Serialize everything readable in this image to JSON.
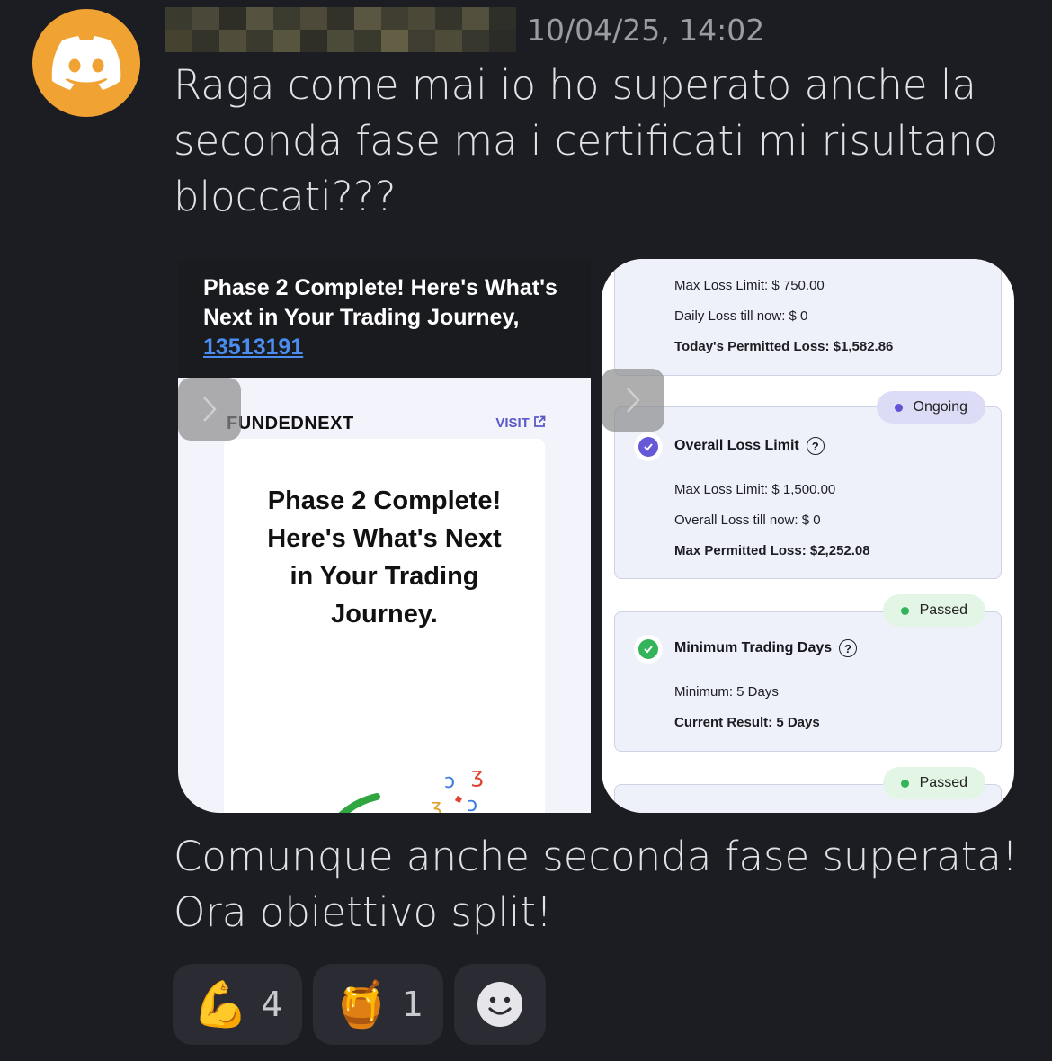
{
  "message": {
    "timestamp": "10/04/25, 14:02",
    "text_1": "Raga come mai io ho superato anche la seconda fase ma i certificati mi risultano bloccati???",
    "text_2": "Comunque anche seconda fase superata! Ora obiettivo split!"
  },
  "attachment_left": {
    "header_title": "Phase 2 Complete! Here's What's Next in Your Trading Journey,",
    "header_link": "13513191",
    "logo_text": "FUNDEDNEXT",
    "visit_label": "VISIT",
    "card_title": "Phase 2 Complete! Here's What's Next in Your Trading Journey."
  },
  "attachment_right": {
    "daily_box": {
      "max_loss_limit": "Max Loss Limit: $ 750.00",
      "loss_till_now": "Daily Loss till now: $ 0",
      "permitted": "Today's Permitted Loss: $1,582.86"
    },
    "overall_box": {
      "status": "Ongoing",
      "title": "Overall Loss Limit",
      "max_loss_limit": "Max Loss Limit: $ 1,500.00",
      "loss_till_now": "Overall Loss till now: $ 0",
      "permitted": "Max Permitted Loss: $2,252.08"
    },
    "days_box": {
      "status": "Passed",
      "title": "Minimum Trading Days",
      "minimum": "Minimum: 5 Days",
      "result": "Current Result: 5 Days"
    },
    "next_box": {
      "status": "Passed"
    }
  },
  "reactions": [
    {
      "emoji": "💪",
      "icon": "flexed-biceps",
      "count": "4"
    },
    {
      "emoji": "🍯",
      "icon": "honey-pot",
      "count": "1"
    }
  ],
  "colors": {
    "background": "#1c1d22",
    "avatar": "#f0a232",
    "ongoing": "#5f55d4",
    "passed": "#33b35a",
    "link": "#4a8cf0"
  }
}
